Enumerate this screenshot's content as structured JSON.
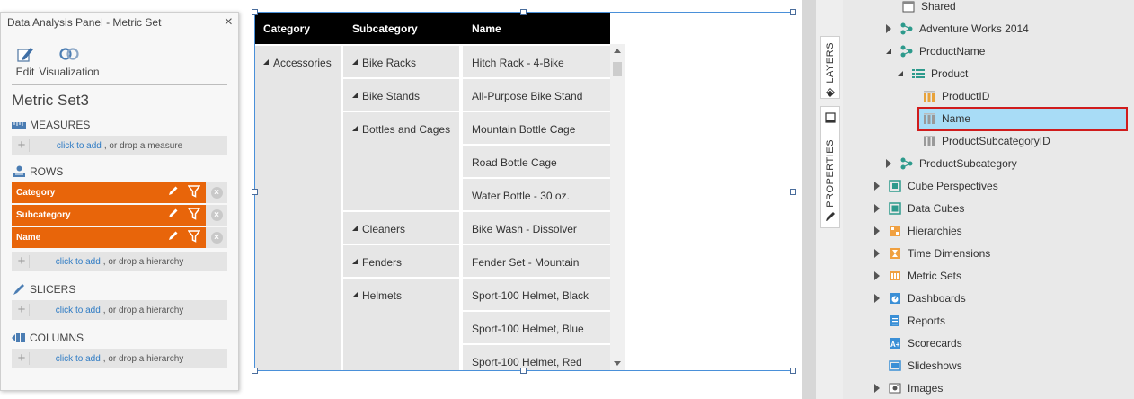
{
  "panel": {
    "title": "Data Analysis Panel - Metric Set",
    "close": "×",
    "tools": [
      {
        "label": "Edit",
        "icon": "pencil-page-icon"
      },
      {
        "label": "Visualization",
        "icon": "visualization-icon"
      }
    ],
    "metric_set_name": "Metric Set3",
    "sections": {
      "measures": {
        "label": "MEASURES",
        "link": "click to add",
        "rest": ", or drop a measure"
      },
      "rows": {
        "label": "ROWS",
        "link": "click to add",
        "rest": ", or drop a hierarchy",
        "items": [
          "Category",
          "Subcategory",
          "Name"
        ]
      },
      "slicers": {
        "label": "SLICERS",
        "link": "click to add",
        "rest": ", or drop a hierarchy"
      },
      "columns": {
        "label": "COLUMNS",
        "link": "click to add",
        "rest": ", or drop a hierarchy"
      }
    },
    "plus": "+",
    "remove": "×"
  },
  "table": {
    "headers": [
      "Category",
      "Subcategory",
      "Name"
    ],
    "category": "Accessories",
    "subcategories": [
      "Bike Racks",
      "Bike Stands",
      "Bottles and Cages",
      "Cleaners",
      "Fenders",
      "Helmets"
    ],
    "names": [
      "Hitch Rack - 4-Bike",
      "All-Purpose Bike Stand",
      "Mountain Bottle Cage",
      "Road Bottle Cage",
      "Water Bottle - 30 oz.",
      "Bike Wash - Dissolver",
      "Fender Set - Mountain",
      "Sport-100 Helmet, Black",
      "Sport-100 Helmet, Blue",
      "Sport-100 Helmet, Red"
    ]
  },
  "side_tabs": {
    "layers": "LAYERS",
    "properties": "PROPERTIES"
  },
  "tree": {
    "shared": "Shared",
    "adventure_works": "Adventure Works 2014",
    "product_name": "ProductName",
    "product": "Product",
    "product_id": "ProductID",
    "name": "Name",
    "product_subcategory_id": "ProductSubcategoryID",
    "product_subcategory": "ProductSubcategory",
    "cube_perspectives": "Cube Perspectives",
    "data_cubes": "Data Cubes",
    "hierarchies": "Hierarchies",
    "time_dimensions": "Time Dimensions",
    "metric_sets": "Metric Sets",
    "dashboards": "Dashboards",
    "reports": "Reports",
    "scorecards": "Scorecards",
    "slideshows": "Slideshows",
    "images": "Images"
  },
  "colors": {
    "accent_orange": "#e8650a",
    "selection_blue": "#a8dcf6",
    "highlight_red": "#d01c1c",
    "link_blue": "#2e7bc4"
  }
}
